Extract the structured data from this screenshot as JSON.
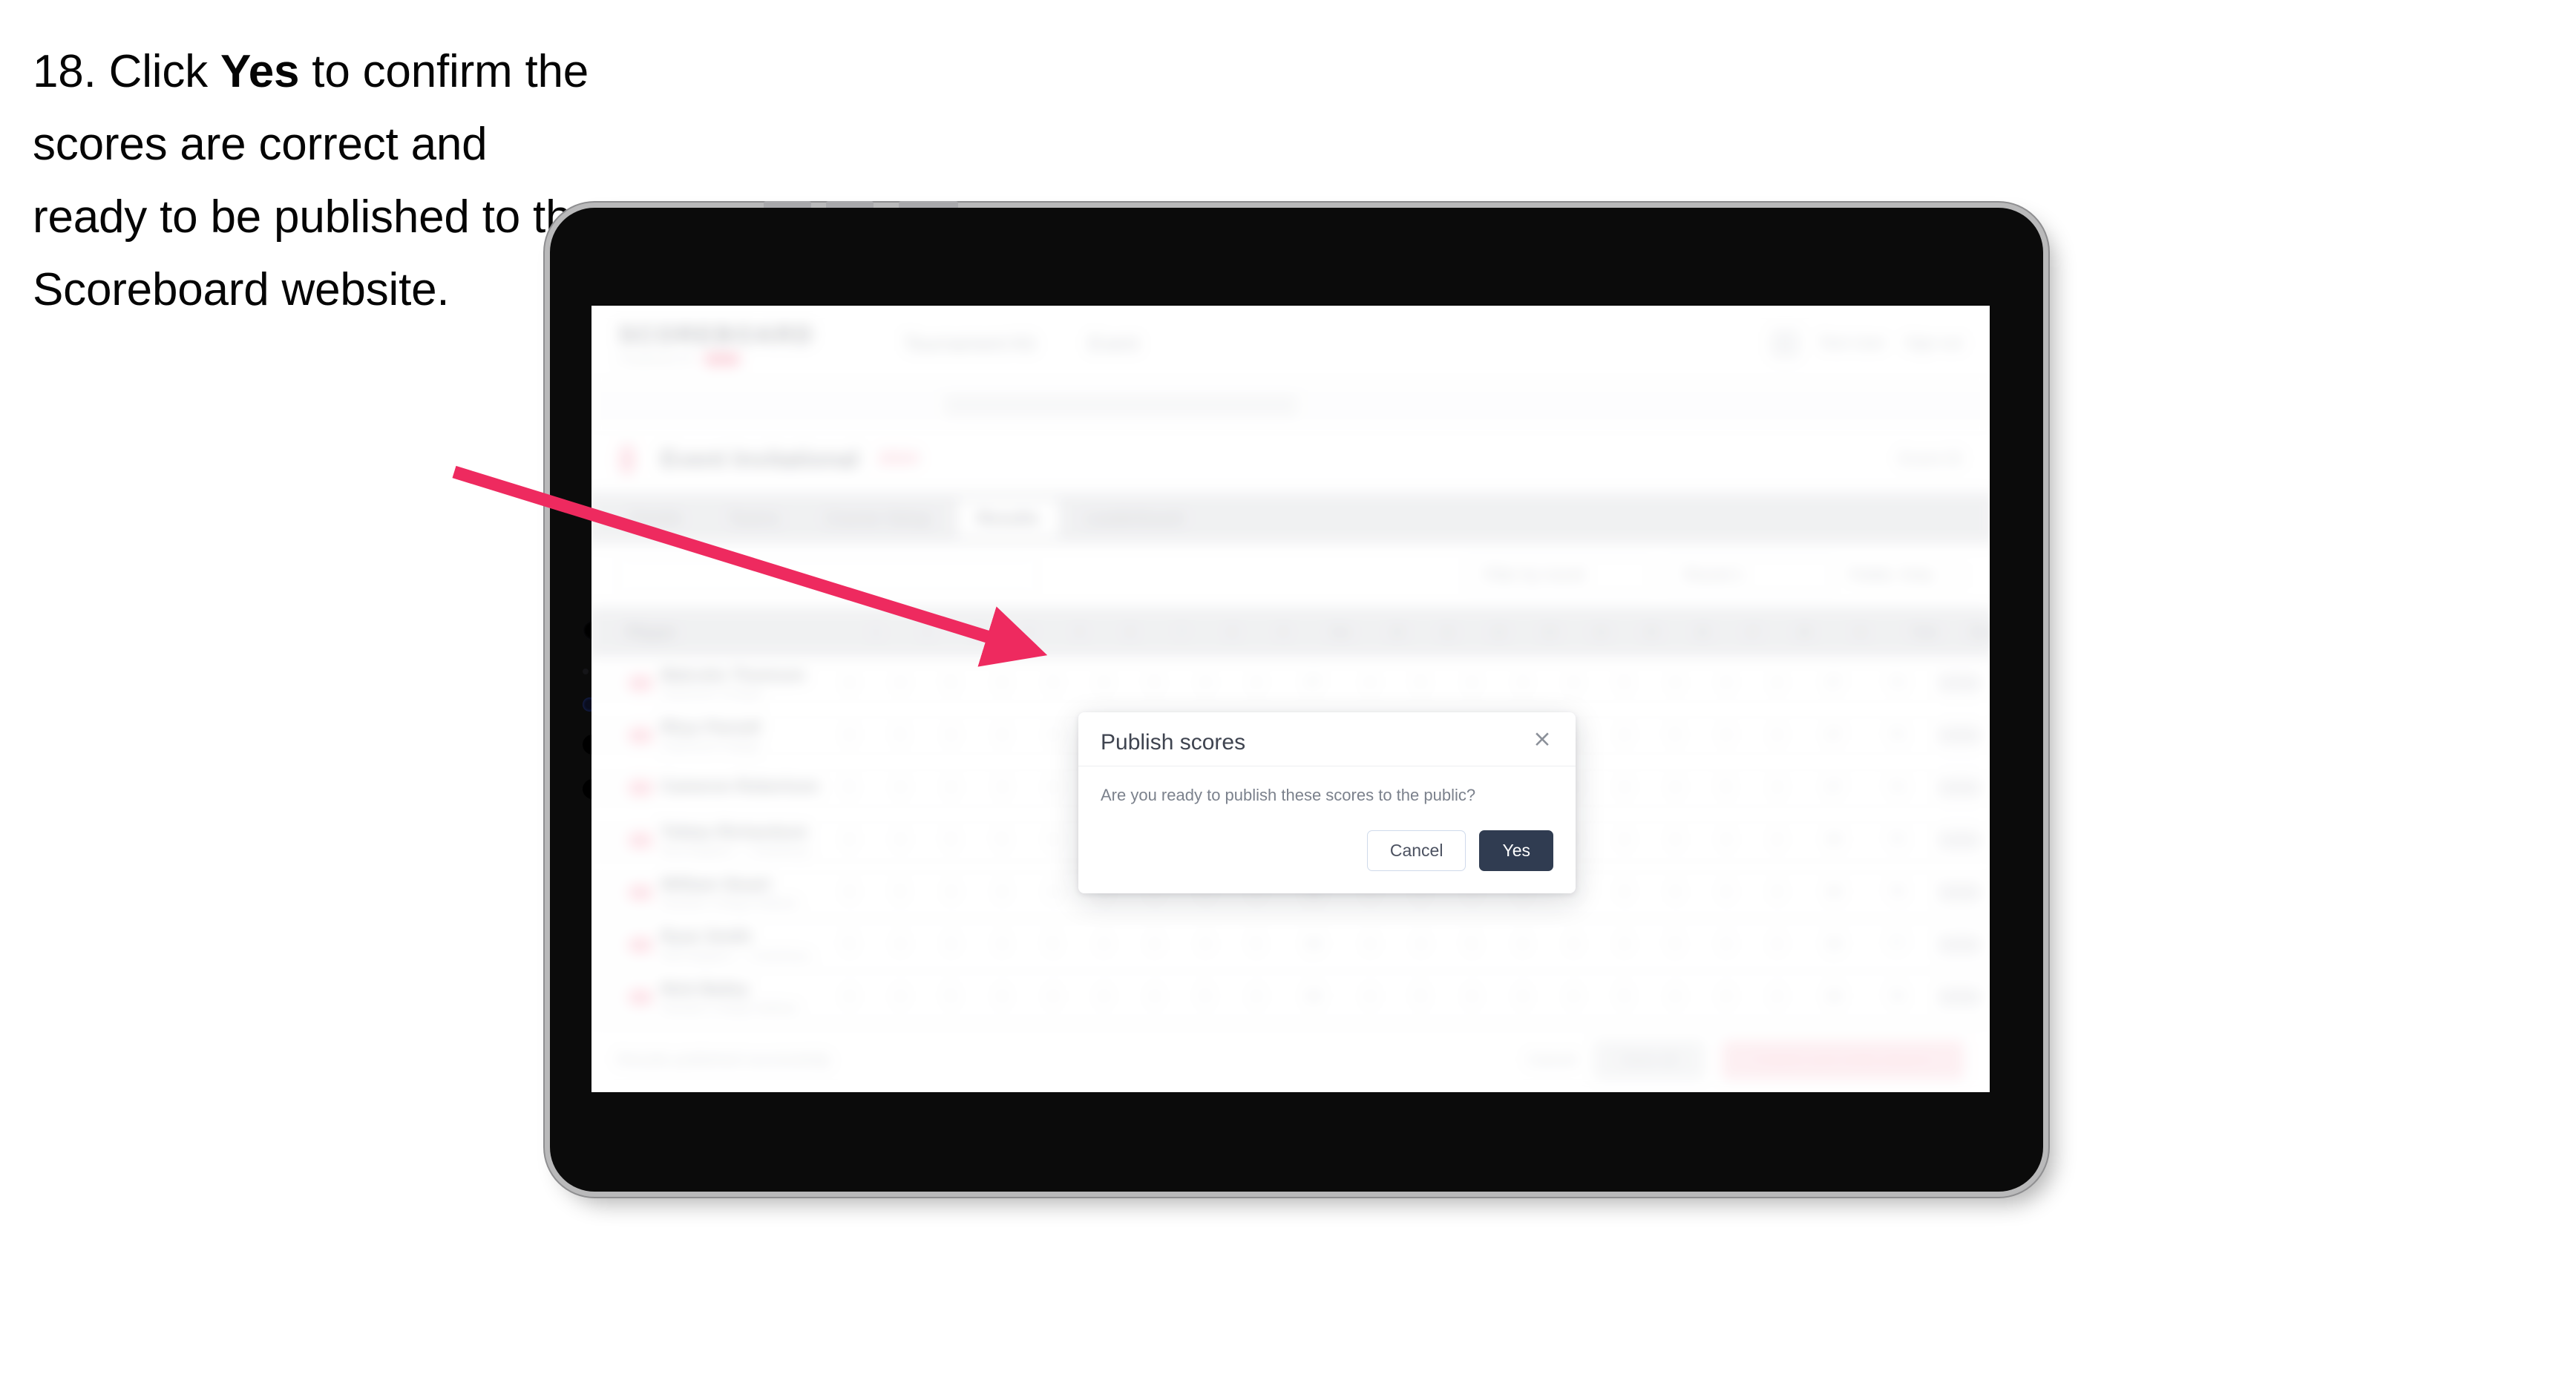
{
  "instruction": {
    "number": "18.",
    "before_bold": " Click ",
    "bold": "Yes",
    "after_bold": " to confirm the scores are correct and ready to be published to the Scoreboard website."
  },
  "colors": {
    "arrow": "#ee2a5f",
    "modal_primary": "#303c51",
    "brand_pink": "#f4889f",
    "device_bezel": "#0b0b0b",
    "device_frame": "#b9b9ba"
  },
  "modal": {
    "title": "Publish scores",
    "close_label": "×",
    "body": "Are you ready to publish these scores to the public?",
    "cancel_label": "Cancel",
    "confirm_label": "Yes"
  },
  "app": {
    "logo": {
      "word": "SCOREBOARD",
      "subtitle": "POWERED BY",
      "badge": ""
    },
    "header_nav": [
      "Tournament Kit",
      "Event"
    ],
    "header_right": {
      "user": "Test User",
      "signout": "Sign out"
    },
    "event": {
      "name": "Event Invitational",
      "tag": "2024",
      "right": "Event ID"
    },
    "tabs": [
      {
        "label": "Details",
        "active": false
      },
      {
        "label": "Teams",
        "active": false
      },
      {
        "label": "Course Setup",
        "active": false
      },
      {
        "label": "Results",
        "active": true
      },
      {
        "label": "Leaderboard",
        "active": false
      }
    ],
    "filters": {
      "search_placeholder": "Search",
      "round_select": "Filter by round",
      "group_select": "Round 1",
      "display_control": "Fields: Only"
    },
    "table": {
      "columns": [
        "Player",
        "1",
        "2",
        "3",
        "4",
        "5",
        "6",
        "7",
        "8",
        "9",
        "Out",
        "10",
        "11",
        "12",
        "13",
        "14",
        "15",
        "16",
        "17",
        "18",
        "In",
        "Total",
        "Status"
      ],
      "rows": [
        {
          "name": "Malcolm Thomson",
          "team": "Claremont Trinidad",
          "scores": [
            "4",
            "4",
            "5",
            "4",
            "3",
            "4",
            "5",
            "4",
            "4",
            "37",
            "4",
            "5",
            "4",
            "3",
            "4",
            "5",
            "4",
            "4",
            "4",
            "37",
            "74"
          ],
          "total": "74",
          "status": "Verified"
        },
        {
          "name": "Rhys Parnell",
          "team": "Claremont College",
          "scores": [
            "4",
            "5",
            "4",
            "4",
            "3",
            "5",
            "4",
            "4",
            "5",
            "38",
            "5",
            "4",
            "4",
            "4",
            "3",
            "4",
            "5",
            "4",
            "4",
            "37",
            "75"
          ],
          "total": "75",
          "status": "Verified"
        },
        {
          "name": "Cameron Robertson",
          "team": "",
          "scores": [
            "5",
            "4",
            "4",
            "3",
            "4",
            "4",
            "5",
            "4",
            "4",
            "37",
            "4",
            "4",
            "5",
            "4",
            "4",
            "4",
            "4",
            "5",
            "3",
            "37",
            "74"
          ],
          "total": "74",
          "status": "Verified"
        },
        {
          "name": "Tobias Richardson",
          "team": "New Brighton — Canterbury",
          "scores": [
            "4",
            "4",
            "5",
            "5",
            "4",
            "4",
            "4",
            "3",
            "4",
            "37",
            "5",
            "4",
            "4",
            "4",
            "5",
            "4",
            "4",
            "4",
            "4",
            "38",
            "75"
          ],
          "total": "75",
          "status": "Verified"
        },
        {
          "name": "William Stuart",
          "team": "Hamilton College Waikato",
          "scores": [
            "4",
            "5",
            "4",
            "4",
            "4",
            "5",
            "4",
            "4",
            "4",
            "38",
            "4",
            "5",
            "4",
            "5",
            "4",
            "4",
            "4",
            "4",
            "4",
            "38",
            "76"
          ],
          "total": "76",
          "status": "Verified"
        },
        {
          "name": "Ryan Smith",
          "team": "New Brighton — Canterbury",
          "scores": [
            "5",
            "4",
            "4",
            "4",
            "5",
            "4",
            "4",
            "4",
            "5",
            "39",
            "4",
            "4",
            "5",
            "4",
            "4",
            "4",
            "5",
            "4",
            "4",
            "38",
            "77"
          ],
          "total": "77",
          "status": "Verified"
        },
        {
          "name": "Nick Bailey",
          "team": "Hamilton College Waikato",
          "scores": [
            "4",
            "4",
            "5",
            "4",
            "4",
            "4",
            "4",
            "5",
            "4",
            "38",
            "4",
            "5",
            "4",
            "4",
            "4",
            "5",
            "4",
            "4",
            "4",
            "38",
            "76"
          ],
          "total": "76",
          "status": "Verified"
        }
      ]
    },
    "footer": {
      "note": "Results published successfully",
      "link": "Cancel",
      "secondary_button": "Save all",
      "primary_button": "Publish and notify players"
    }
  }
}
